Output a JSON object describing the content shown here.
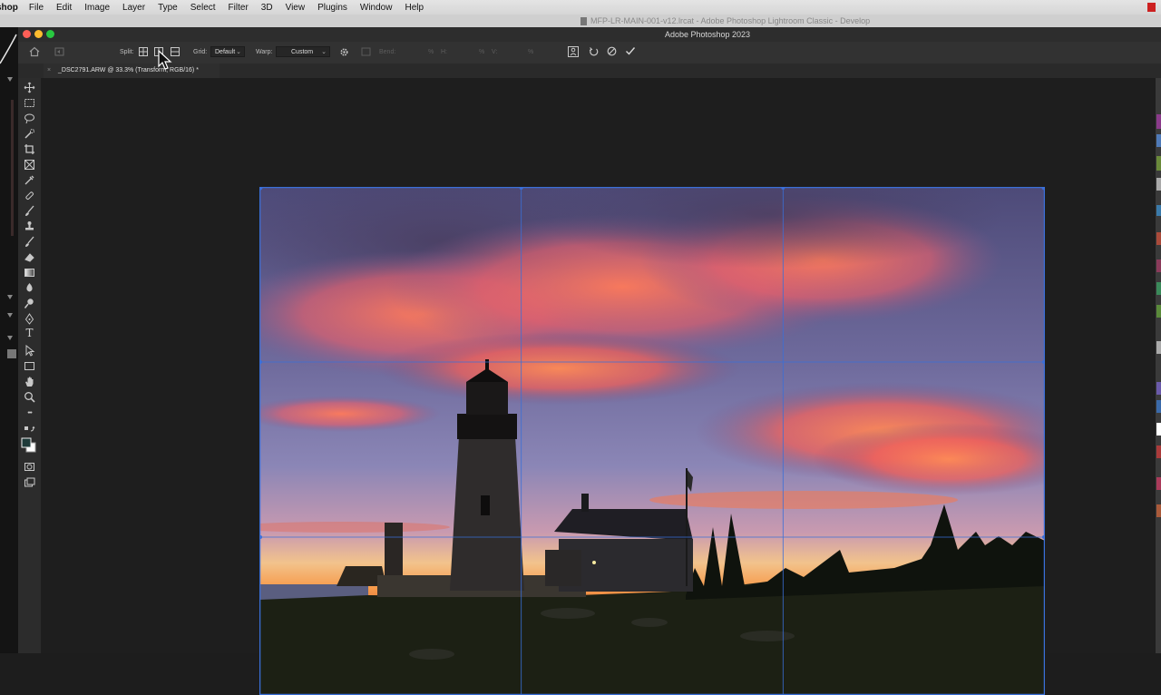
{
  "menubar": {
    "app_name": "shop",
    "items": [
      "File",
      "Edit",
      "Image",
      "Layer",
      "Type",
      "Select",
      "Filter",
      "3D",
      "View",
      "Plugins",
      "Window",
      "Help"
    ]
  },
  "lr_window": {
    "title": "MFP-LR-MAIN-001-v12.lrcat - Adobe Photoshop Lightroom Classic - Develop"
  },
  "ps_window": {
    "title": "Adobe Photoshop 2023"
  },
  "options_bar": {
    "split_label": "Split:",
    "grid_label": "Grid:",
    "grid_value": "Default",
    "warp_label": "Warp:",
    "warp_value": "Custom",
    "bend_label": "Bend:",
    "pct1": "%",
    "h_label": "H:",
    "pct2": "%",
    "v_label": "V:",
    "pct3": "%"
  },
  "document": {
    "tab_title": "_DSC2791.ARW @ 33.3% (Transform, RGB/16) *",
    "close_glyph": "×"
  },
  "toolbar": {
    "type_tool_glyph": "T",
    "more_glyph": "•••"
  },
  "colors": {
    "accent": "#3a6fd8",
    "close_dot": "#fe5f57",
    "minimize_dot": "#febc2e",
    "zoom_dot": "#28c840"
  },
  "icons": [
    "home-icon",
    "transform-icon",
    "split-cross-icon",
    "split-vertical-icon",
    "split-horizontal-icon",
    "settings-gear-icon",
    "puppet-warp-icon",
    "reset-icon",
    "cancel-icon",
    "commit-check-icon",
    "cursor-arrow-icon"
  ]
}
